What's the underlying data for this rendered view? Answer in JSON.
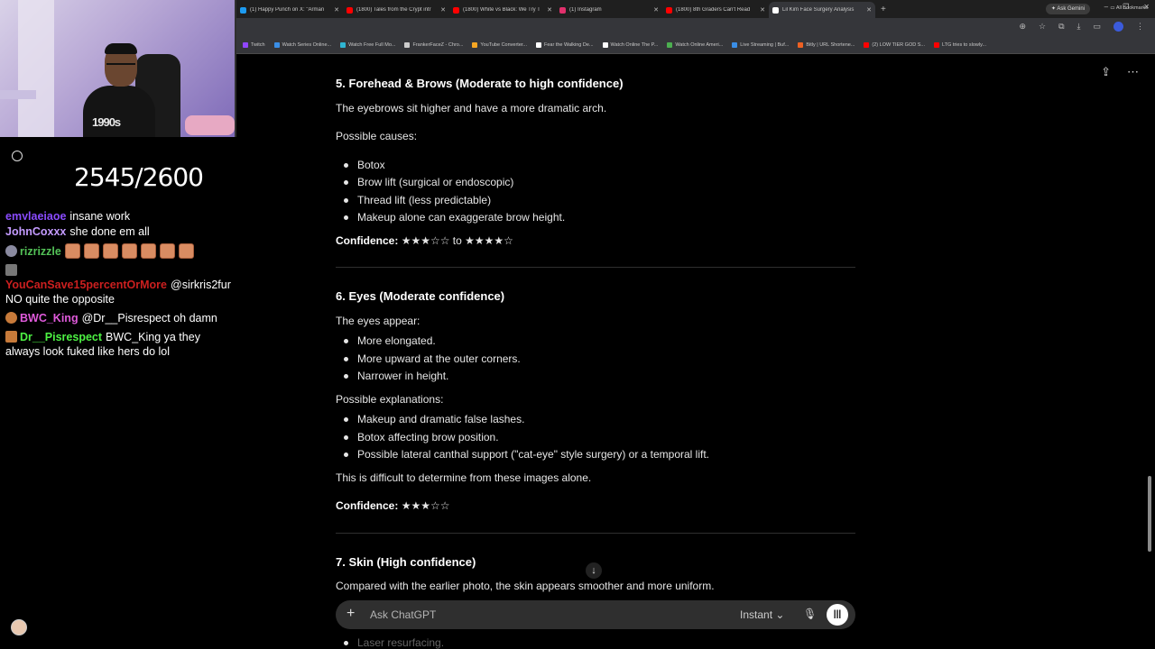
{
  "browser": {
    "tabs": [
      {
        "title": "(1) Happy Punch on X: \"Arman",
        "color": "#1d9bf0",
        "active": false
      },
      {
        "title": "(1800) Tales from the Crypt intr",
        "color": "#ff0000",
        "active": false
      },
      {
        "title": "(1800) White vs Black: We Try T",
        "color": "#ff0000",
        "active": false
      },
      {
        "title": "(1) Instagram",
        "color": "#e1306c",
        "active": false
      },
      {
        "title": "(1800) 8th Graders Can't Read",
        "color": "#ff0000",
        "active": false
      },
      {
        "title": "Lil Kim Face Surgery Analysis",
        "color": "#ffffff",
        "active": true
      }
    ],
    "new_tab": "+",
    "ask_gemini": "Ask Gemini",
    "bookmarks": [
      {
        "label": "Twitch",
        "color": "#9146ff"
      },
      {
        "label": "Watch Series Online...",
        "color": "#3a8ee6"
      },
      {
        "label": "Watch Free Full Mo...",
        "color": "#2fb5d2"
      },
      {
        "label": "FrankerFaceZ - Chro...",
        "color": "#cccccc"
      },
      {
        "label": "YouTube Converter...",
        "color": "#f5a623"
      },
      {
        "label": "Fear the Walking De...",
        "color": "#ffffff"
      },
      {
        "label": "Watch Online The P...",
        "color": "#ffffff"
      },
      {
        "label": "Watch Online Ameri...",
        "color": "#4caf50"
      },
      {
        "label": "Live Streaming | Buf...",
        "color": "#3a8ee6"
      },
      {
        "label": "Bitly | URL Shortene...",
        "color": "#ee6123"
      },
      {
        "label": "(2) LOW TIER GOD S...",
        "color": "#ff0000"
      },
      {
        "label": "LTG tries to slowly...",
        "color": "#ff0000"
      }
    ],
    "all_bookmarks": "All Bookmarks"
  },
  "stream": {
    "counter": "2545/2600",
    "shirt_text": "1990s",
    "chat": [
      {
        "user": "emylaeiaoe",
        "user_color": "#8a4bff",
        "text": "insane work",
        "cut": true
      },
      {
        "user": "JohnCoxxx",
        "user_color": "#c49bff",
        "text": "she done em all"
      },
      {
        "user": "rizrizzle",
        "user_color": "#53c257",
        "text": "",
        "emotes": 7
      },
      {
        "user": "YouCanSave15percentOrMore",
        "user_color": "#cc1f1f",
        "text": "@sirkris2fur NO quite the opposite"
      },
      {
        "user": "BWC_King",
        "user_color": "#e05adb",
        "text": "@Dr__Pisrespect oh damn"
      },
      {
        "user": "Dr__Pisrespect",
        "user_color": "#4df243",
        "text": "BWC_King ya they always look fuked like hers do lol"
      }
    ]
  },
  "chatgpt": {
    "s5": {
      "heading": "5. Forehead & Brows (Moderate to high confidence)",
      "intro": "The eyebrows sit higher and have a more dramatic arch.",
      "causes_label": "Possible causes:",
      "causes": [
        "Botox",
        "Brow lift (surgical or endoscopic)",
        "Thread lift (less predictable)",
        "Makeup alone can exaggerate brow height."
      ],
      "confidence_label": "Confidence:",
      "confidence_value": "★★★☆☆ to ★★★★☆"
    },
    "s6": {
      "heading": "6. Eyes (Moderate confidence)",
      "intro": "The eyes appear:",
      "points": [
        "More elongated.",
        "More upward at the outer corners.",
        "Narrower in height."
      ],
      "expl_label": "Possible explanations:",
      "explanations": [
        "Makeup and dramatic false lashes.",
        "Botox affecting brow position.",
        "Possible lateral canthal support (\"cat-eye\" style surgery) or a temporal lift."
      ],
      "note": "This is difficult to determine from these images alone.",
      "confidence_label": "Confidence:",
      "confidence_value": "★★★☆☆"
    },
    "s7": {
      "heading": "7. Skin (High confidence)",
      "intro": "Compared with the earlier photo, the skin appears smoother and more uniform.",
      "faded_item": "Laser resurfacing."
    },
    "composer": {
      "placeholder": "Ask ChatGPT",
      "model": "Instant"
    }
  }
}
